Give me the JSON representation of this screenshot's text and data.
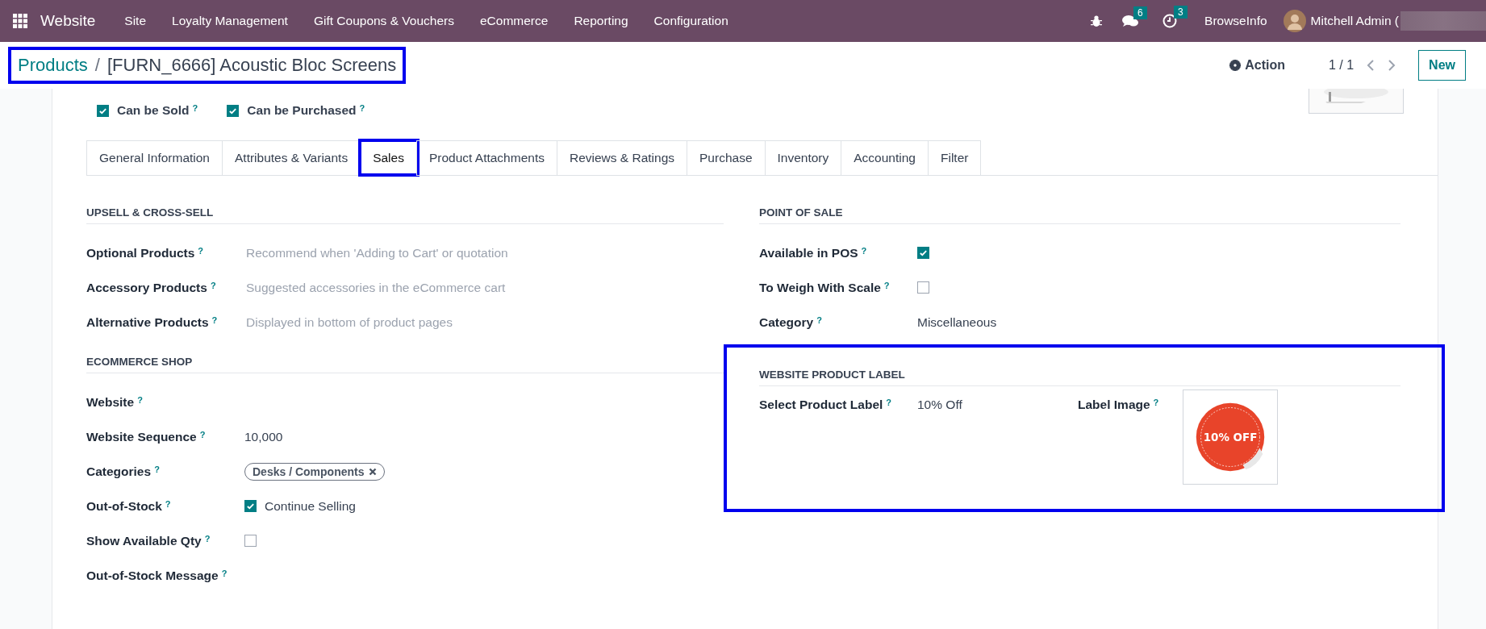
{
  "navbar": {
    "app": "Website",
    "menu": [
      "Site",
      "Loyalty Management",
      "Gift Coupons & Vouchers",
      "eCommerce",
      "Reporting",
      "Configuration"
    ],
    "discuss_count": "6",
    "activity_count": "3",
    "company": "BrowseInfo",
    "user": "Mitchell Admin ("
  },
  "breadcrumb": {
    "parent": "Products",
    "separator": "/",
    "current": "[FURN_6666] Acoustic Bloc Screens",
    "highlighted": true
  },
  "control_panel": {
    "action": "Action",
    "pager": "1 / 1",
    "new_button": "New"
  },
  "flags": [
    {
      "label": "Can be Sold",
      "help": "?",
      "checked": true
    },
    {
      "label": "Can be Purchased",
      "help": "?",
      "checked": true
    }
  ],
  "tabs": [
    {
      "label": "General Information",
      "selected": false,
      "highlighted": false
    },
    {
      "label": "Attributes & Variants",
      "selected": false,
      "highlighted": false
    },
    {
      "label": "Sales",
      "selected": true,
      "highlighted": true
    },
    {
      "label": "Product Attachments",
      "selected": false,
      "highlighted": false
    },
    {
      "label": "Reviews & Ratings",
      "selected": false,
      "highlighted": false
    },
    {
      "label": "Purchase",
      "selected": false,
      "highlighted": false
    },
    {
      "label": "Inventory",
      "selected": false,
      "highlighted": false
    },
    {
      "label": "Accounting",
      "selected": false,
      "highlighted": false
    },
    {
      "label": "Filter",
      "selected": false,
      "highlighted": false
    }
  ],
  "left_sections": [
    {
      "title": "UPSELL & CROSS-SELL",
      "kind": "stacked",
      "highlighted": false,
      "fields": [
        {
          "label": "Optional Products",
          "help": "?",
          "kind": "placeholder",
          "placeholder": "Recommend when 'Adding to Cart' or quotation"
        },
        {
          "label": "Accessory Products",
          "help": "?",
          "kind": "placeholder",
          "placeholder": "Suggested accessories in the eCommerce cart"
        },
        {
          "label": "Alternative Products",
          "help": "?",
          "kind": "placeholder",
          "placeholder": "Displayed in bottom of product pages"
        }
      ]
    },
    {
      "title": "ECOMMERCE SHOP",
      "kind": "stacked",
      "highlighted": false,
      "fields": [
        {
          "label": "Website",
          "help": "?",
          "kind": "empty"
        },
        {
          "label": "Website Sequence",
          "help": "?",
          "kind": "text",
          "value": "10,000"
        },
        {
          "label": "Categories",
          "help": "?",
          "kind": "tags",
          "tags": [
            "Desks / Components"
          ]
        },
        {
          "label": "Out-of-Stock",
          "help": "?",
          "kind": "checkbox",
          "checked": true,
          "text": "Continue Selling"
        },
        {
          "label": "Show Available Qty",
          "help": "?",
          "kind": "checkbox",
          "checked": false
        },
        {
          "label": "Out-of-Stock Message",
          "help": "?",
          "kind": "empty"
        }
      ]
    }
  ],
  "right_sections": [
    {
      "title": "POINT OF SALE",
      "kind": "stacked",
      "highlighted": false,
      "fields": [
        {
          "label": "Available in POS",
          "help": "?",
          "kind": "checkbox",
          "checked": true
        },
        {
          "label": "To Weigh With Scale",
          "help": "?",
          "kind": "checkbox",
          "checked": false
        },
        {
          "label": "Category",
          "help": "?",
          "kind": "text",
          "value": "Miscellaneous"
        }
      ]
    },
    {
      "title": "WEBSITE PRODUCT LABEL",
      "kind": "inline",
      "highlighted": true,
      "fields": [
        {
          "label": "Select Product Label",
          "help": "?",
          "kind": "text",
          "value": "10% Off"
        },
        {
          "label": "Label Image",
          "help": "?",
          "image_text": "10% OFF"
        }
      ]
    }
  ]
}
